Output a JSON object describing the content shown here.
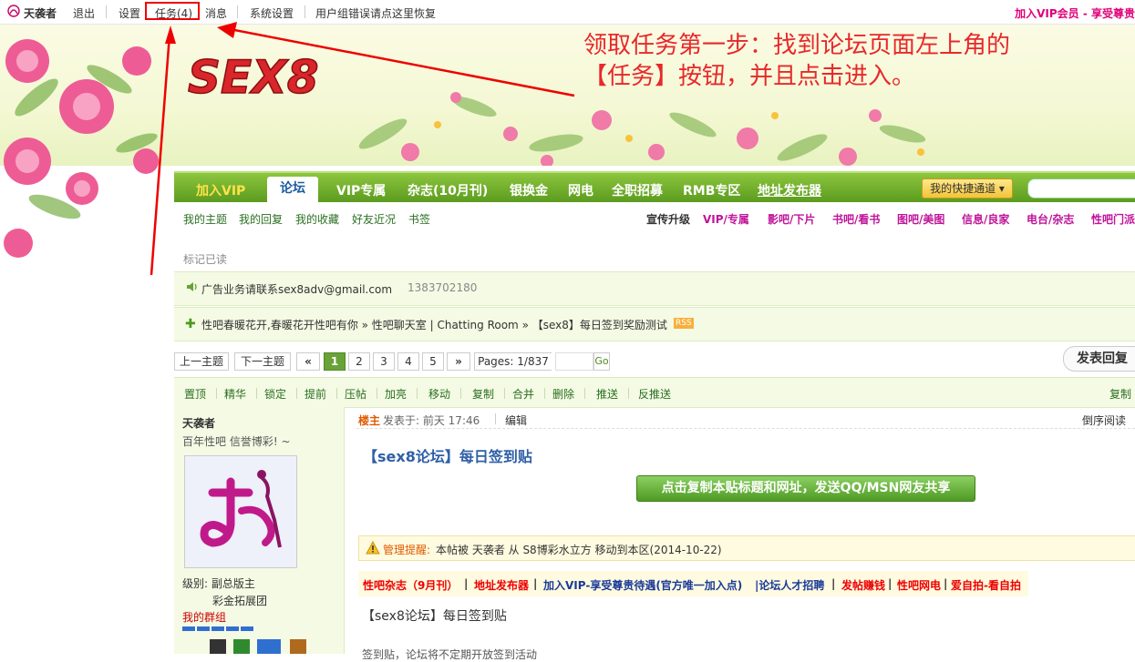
{
  "topbar": {
    "username": "天袭者",
    "logout": "退出",
    "settings": "设置",
    "tasks": "任务(4)",
    "messages": "消息",
    "system_settings": "系统设置",
    "group_error": "用户组错误请点这里恢复",
    "vip_link": "加入VIP会员 - 享受尊贵"
  },
  "banner": {
    "logo_text": "SEX8",
    "instruction_line1": "领取任务第一步：找到论坛页面左上角的",
    "instruction_line2": "【任务】按钮，并且点击进入。"
  },
  "nav": {
    "items": [
      "加入VIP",
      "论坛",
      "VIP专属",
      "杂志(10月刊)",
      "银换金",
      "网电",
      "全职招募",
      "RMB专区",
      "地址发布器"
    ],
    "quick_access": "我的快捷通道 ▾"
  },
  "subnav": {
    "left": [
      "我的主题",
      "我的回复",
      "我的收藏",
      "好友近况",
      "书签"
    ],
    "right": [
      "宣传升级",
      "VIP/专属",
      "影吧/下片",
      "书吧/看书",
      "图吧/美图",
      "信息/良家",
      "电台/杂志",
      "性吧门派"
    ]
  },
  "mark_read": "标记已读",
  "ad_bar": {
    "text": "广告业务请联系sex8adv@gmail.com",
    "phone": "1383702180"
  },
  "breadcrumb": {
    "text": "性吧春暖花开,春暖花开性吧有你 » 性吧聊天室 | Chatting Room » 【sex8】每日签到奖励测试",
    "rss": "RSS"
  },
  "pager": {
    "prev_topic": "上一主题",
    "next_topic": "下一主题",
    "first": "«",
    "pages": [
      "1",
      "2",
      "3",
      "4",
      "5"
    ],
    "next": "»",
    "pages_label": "Pages: 1/837",
    "go": "Go",
    "reply": "发表回复"
  },
  "mod_tools": [
    "置顶",
    "精华",
    "锁定",
    "提前",
    "压帖",
    "加亮",
    "移动",
    "复制",
    "合并",
    "删除",
    "推送",
    "反推送"
  ],
  "mod_right": "复制",
  "post": {
    "author": "天袭者",
    "motto": "百年性吧 信誉博彩! ~",
    "level": "级别: 副总版主",
    "rank2": "彩金拓展团",
    "my_group": "我的群组",
    "floor": "楼主",
    "posted": "发表于: 前天 17:46",
    "edit": "编辑",
    "reverse": "倒序阅读",
    "title": "【sex8论坛】每日签到贴",
    "copy_button": "点击复制本贴标题和网址，发送QQ/MSN网友共享",
    "notice_label": "管理提醒:",
    "notice_text": "本帖被 天袭者 从 S8博彩水立方 移动到本区(2014-10-22)",
    "ad_links": [
      "性吧杂志（9月刊）",
      "|",
      "地址发布器",
      "|",
      "加入VIP-享受尊贵待遇(官方唯一加入点)",
      "|论坛人才招聘",
      "|",
      "发帖赚钱",
      "|",
      "性吧网电",
      "|",
      "爱自拍-看自拍"
    ],
    "body": "【sex8论坛】每日签到贴",
    "cut_text": "签到贴，论坛将不定期开放签到活动"
  }
}
